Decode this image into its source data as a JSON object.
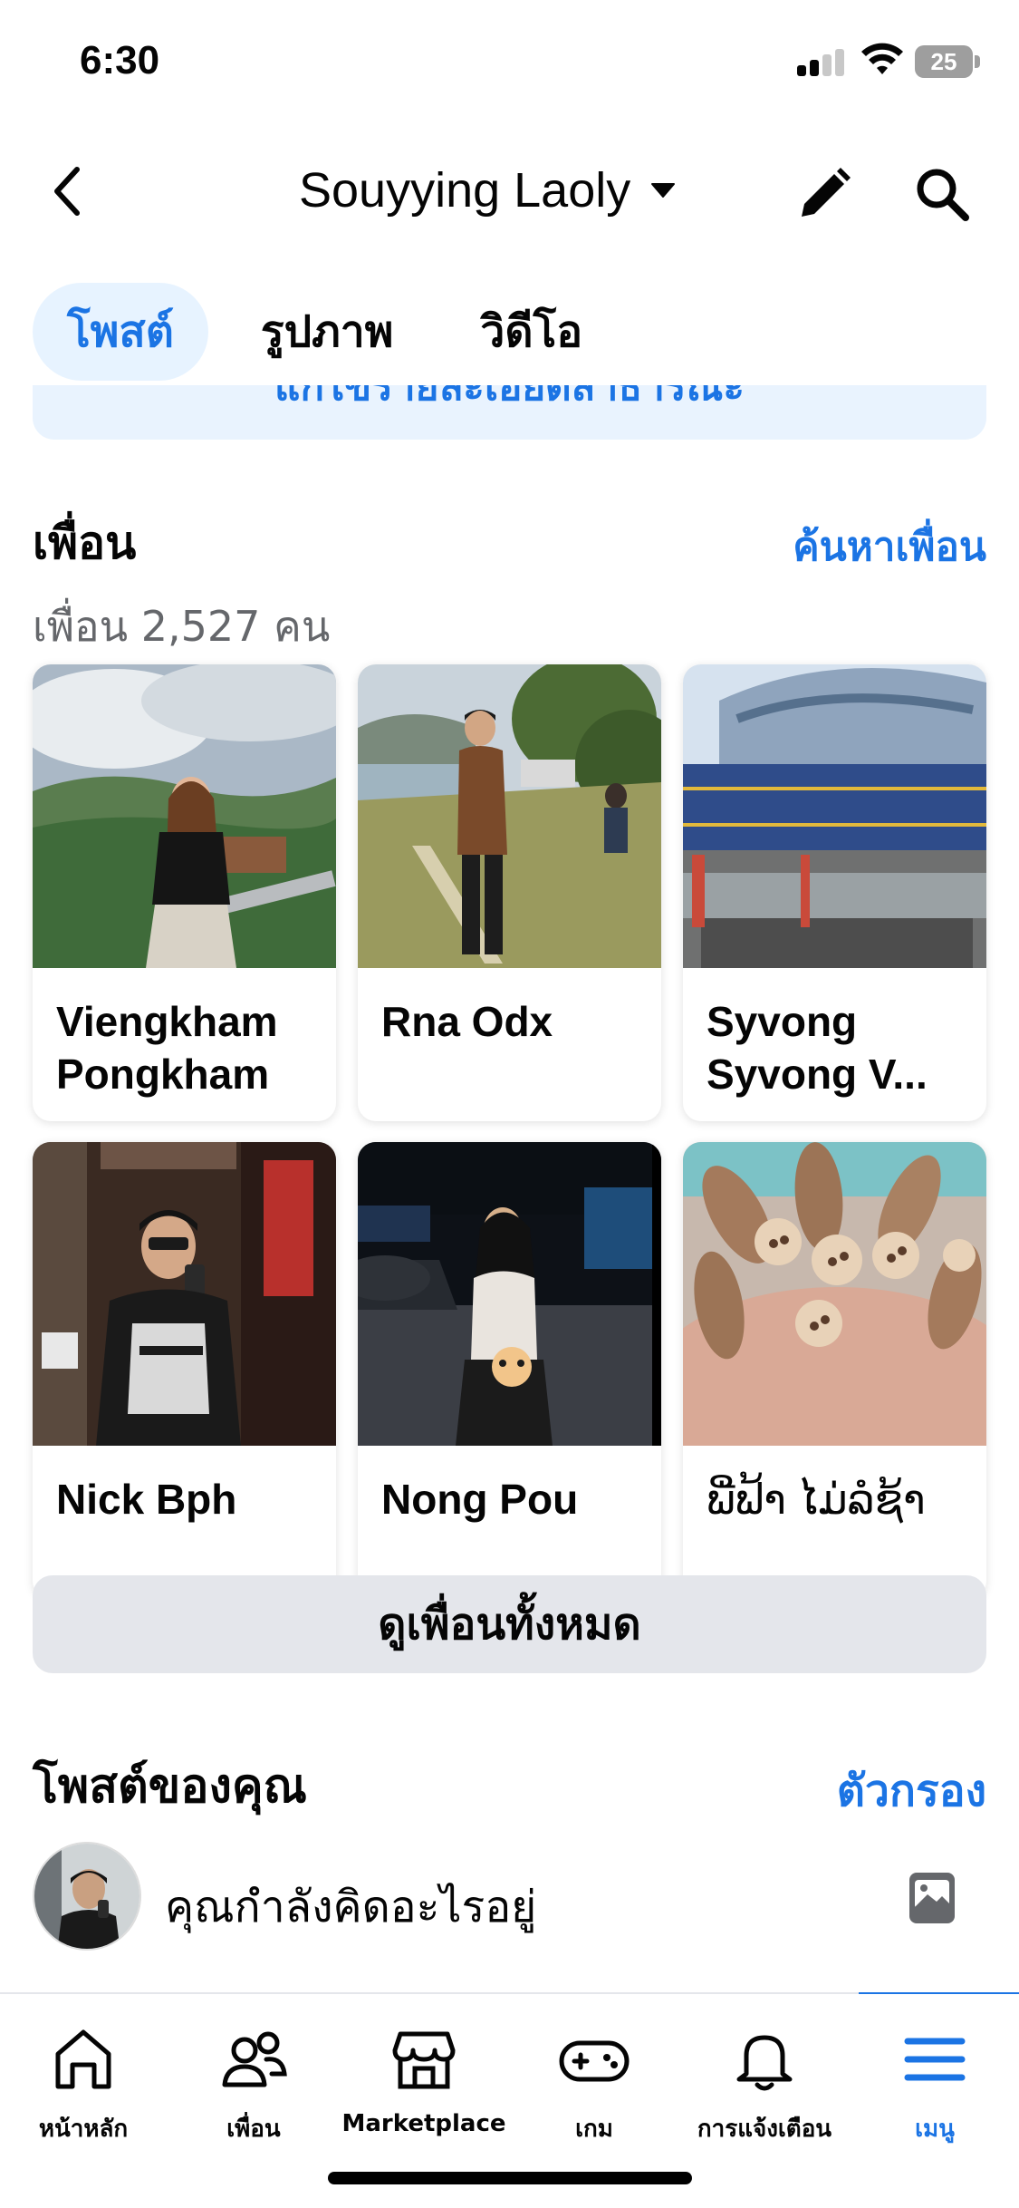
{
  "status": {
    "time": "6:30",
    "battery": "25"
  },
  "header": {
    "title": "Souyying Laoly",
    "back_icon": "chevron-left-icon",
    "edit_icon": "pencil-icon",
    "search_icon": "search-icon"
  },
  "tabs": [
    {
      "label": "โพสต์",
      "active": true
    },
    {
      "label": "รูปภาพ",
      "active": false
    },
    {
      "label": "วิดีโอ",
      "active": false
    }
  ],
  "banner": {
    "text": "แก้ไขรายละเอียดสาธารณะ"
  },
  "friends": {
    "title": "เพื่อน",
    "count": "เพื่อน 2,527 คน",
    "find_link": "ค้นหาเพื่อน",
    "items": [
      {
        "name": "Viengkham Pongkham"
      },
      {
        "name": "Rna Odx"
      },
      {
        "name": "Syvong Syvong V..."
      },
      {
        "name": "Nick Bph"
      },
      {
        "name": "Nong Pou"
      },
      {
        "name": "ພີ່ຟ້າ ໄມ່ລໍຊ້າ"
      }
    ],
    "see_all": "ดูเพื่อนทั้งหมด"
  },
  "posts": {
    "title": "โพสต์ของคุณ",
    "filter_link": "ตัวกรอง",
    "composer_placeholder": "คุณกำลังคิดอะไรอยู่"
  },
  "bottom_nav": [
    {
      "label": "หน้าหลัก",
      "icon": "home-icon",
      "active": false
    },
    {
      "label": "เพื่อน",
      "icon": "friends-icon",
      "active": false
    },
    {
      "label": "Marketplace",
      "icon": "marketplace-icon",
      "active": false
    },
    {
      "label": "เกม",
      "icon": "gaming-icon",
      "active": false
    },
    {
      "label": "การแจ้งเตือน",
      "icon": "bell-icon",
      "active": false
    },
    {
      "label": "เมนู",
      "icon": "menu-icon",
      "active": true
    }
  ],
  "colors": {
    "accent": "#1b74e4",
    "secondary_text": "#65676b",
    "button_gray": "#e4e6eb",
    "tab_active_bg": "#e7f3ff"
  }
}
